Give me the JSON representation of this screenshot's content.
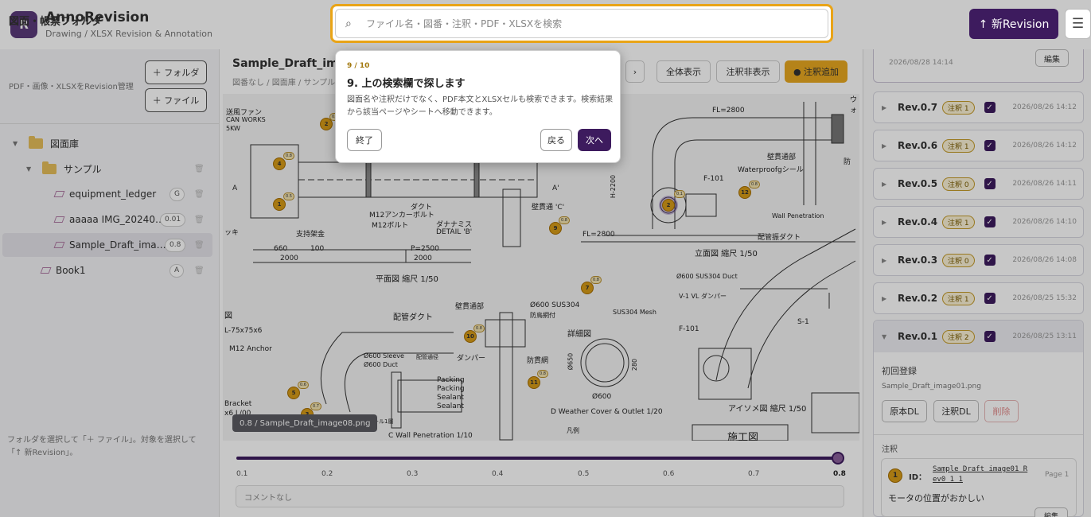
{
  "header": {
    "logo_letter": "R",
    "app_title": "AnnoRevision",
    "app_subtitle": "Drawing / XLSX Revision & Annotation",
    "search_placeholder": "ファイル名・図番・注釈・PDF・XLSXを検索",
    "new_revision_label": "↑ 新Revision",
    "menu_icon": "☰"
  },
  "sidebar": {
    "title": "図面・帳票フォルダ",
    "subtitle": "PDF・画像・XLSXをRevision管理",
    "add_folder_label": "＋ フォルダ",
    "add_file_label": "＋ ファイル",
    "tree": [
      {
        "label": "図面庫",
        "type": "folder",
        "badge": ""
      },
      {
        "label": "サンプル",
        "type": "folder",
        "badge": ""
      },
      {
        "label": "equipment_ledger",
        "type": "file",
        "badge": "G"
      },
      {
        "label": "aaaaa IMG_20240…",
        "type": "file",
        "badge": "0.01"
      },
      {
        "label": "Sample_Draft_ima…",
        "type": "file",
        "badge": "0.8"
      },
      {
        "label": "Book1",
        "type": "file",
        "badge": "A"
      }
    ],
    "footer": "フォルダを選択して「＋ ファイル」。対象を選択して「↑ 新Revision」。"
  },
  "main": {
    "title": "Sample_Draft_ima",
    "breadcrumb": "図番なし / 図面庫 / サンプル",
    "toolbar": {
      "fit_label": "全体表示",
      "hide_annotations_label": "注釈非表示",
      "add_annotation_label": "● 注釈追加",
      "next_icon": "›"
    },
    "drawing": {
      "labels": [
        "送風ファン",
        "CAN WORKS",
        "5KW",
        "FL=2800",
        "ウォ",
        "壁貫通部",
        "Waterproofgシール",
        "防",
        "F-101",
        "H-2200",
        "A",
        "A'",
        "M12アンカーボルト",
        "M12ボルト",
        "ダクト",
        "ダナナミス",
        "DETAIL 'B'",
        "壁貫通 'C'",
        "支持架金",
        "660",
        "100",
        "2000",
        "P=2500",
        "2000",
        "FL=2800",
        "立面図 縮尺 1/50",
        "平面図 縮尺 1/50",
        "Wall Penetration",
        "配管振ダクト",
        "Ø600 SUS304 Duct",
        "V-1 VL ダンパー",
        "F-101",
        "S-1",
        "M12 Anchor",
        "配管ダクト",
        "Ø600 Sleeve",
        "Ø600 Duct",
        "配管通径",
        "壁貫通部",
        "Ø600 SUS304",
        "防鳥網付",
        "ダンパー",
        "防貫網",
        "詳細図",
        "SUS304 Mesh",
        "Ø650",
        "280",
        "Ø600",
        "Packing",
        "Packing",
        "Sealant",
        "Sealant",
        "タール1層",
        "D Weather Cover & Outlet 1/20",
        "C Wall Penetration 1/10",
        "凡例",
        "アイソメ図 縮尺 1/50",
        "施工図",
        "Bracket",
        "x6 L/00",
        "ッキ",
        "図",
        "L-75x75x6"
      ],
      "markers": [
        {
          "num": "2",
          "ver": "0.8"
        },
        {
          "num": "4",
          "ver": "0.8"
        },
        {
          "num": "1",
          "ver": "0.5"
        },
        {
          "num": "9",
          "ver": "0.8"
        },
        {
          "num": "2",
          "ver": "0.1"
        },
        {
          "num": "12",
          "ver": "0.8"
        },
        {
          "num": "7",
          "ver": "0.8"
        },
        {
          "num": "10",
          "ver": "0.8"
        },
        {
          "num": "11",
          "ver": "0.8"
        },
        {
          "num": "5",
          "ver": "0.6"
        },
        {
          "num": "3",
          "ver": "0.7"
        }
      ]
    },
    "tooltip": "0.8 / Sample_Draft_image08.png",
    "slider": {
      "value": 0.8,
      "ticks": [
        "0.1",
        "0.2",
        "0.3",
        "0.4",
        "0.5",
        "0.6",
        "0.7",
        "0.8"
      ]
    },
    "comment_placeholder": "コメントなし"
  },
  "right_panel": {
    "top_date": "2026/08/28 14:14",
    "edit_label": "編集",
    "revisions": [
      {
        "name": "Rev.0.7",
        "badge": "注釈 1",
        "date": "2026/08/26 14:12"
      },
      {
        "name": "Rev.0.6",
        "badge": "注釈 1",
        "date": "2026/08/26 14:12"
      },
      {
        "name": "Rev.0.5",
        "badge": "注釈 0",
        "date": "2026/08/26 14:11"
      },
      {
        "name": "Rev.0.4",
        "badge": "注釈 1",
        "date": "2026/08/26 14:10"
      },
      {
        "name": "Rev.0.3",
        "badge": "注釈 0",
        "date": "2026/08/26 14:08"
      },
      {
        "name": "Rev.0.2",
        "badge": "注釈 1",
        "date": "2026/08/25 15:32"
      }
    ],
    "expanded": {
      "name": "Rev.0.1",
      "badge": "注釈 2",
      "date": "2026/08/25 13:11",
      "note": "初回登録",
      "file": "Sample_Draft_image01.png",
      "original_dl": "原本DL",
      "annotated_dl": "注釈DL",
      "delete": "削除",
      "annotations_header": "注釈",
      "annotation": {
        "num": "1",
        "id_label": "ID：",
        "id_value_line1": "Sample_Draft_image01_R",
        "id_value_line2": "ev0_1_1",
        "page": "Page 1",
        "text": "モータの位置がおかしい",
        "edit": "編集"
      }
    }
  },
  "coach": {
    "step": "9 / 10",
    "title": "9. 上の検索欄で探します",
    "body": "図面名や注釈だけでなく、PDF本文とXLSXセルも検索できます。検索結果から該当ページやシートへ移動できます。",
    "finish_label": "終了",
    "back_label": "戻る",
    "next_label": "次へ"
  },
  "colors": {
    "brand": "#3d1b5e",
    "accent": "#e9a417",
    "marker": "#d79b18"
  }
}
